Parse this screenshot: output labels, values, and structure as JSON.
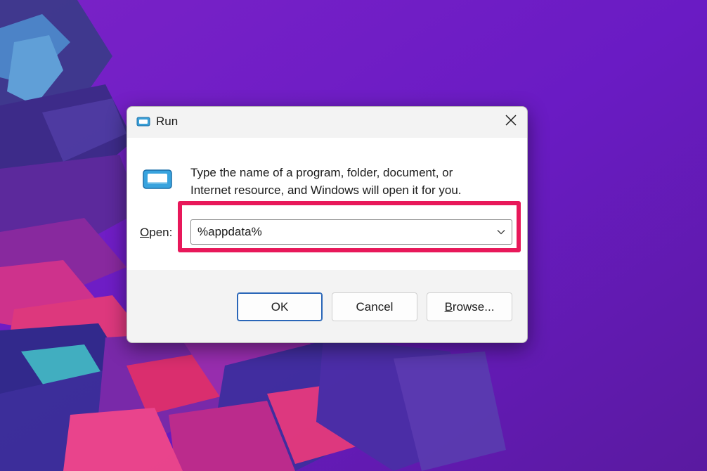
{
  "dialog": {
    "title": "Run",
    "description_line1": "Type the name of a program, folder, document, or",
    "description_line2": "Internet resource, and Windows will open it for you.",
    "open_label_mnemonic": "O",
    "open_label_rest": "pen:",
    "open_value": "%appdata%",
    "buttons": {
      "ok": "OK",
      "cancel": "Cancel",
      "browse_mnemonic": "B",
      "browse_rest": "rowse..."
    }
  },
  "icons": {
    "title": "run-icon",
    "large": "run-icon",
    "close": "close-icon",
    "dropdown": "chevron-down-icon"
  },
  "colors": {
    "highlight": "#e8185a",
    "wallpaper_purple": "#6a1bc4",
    "ok_border": "#2a66b8"
  }
}
